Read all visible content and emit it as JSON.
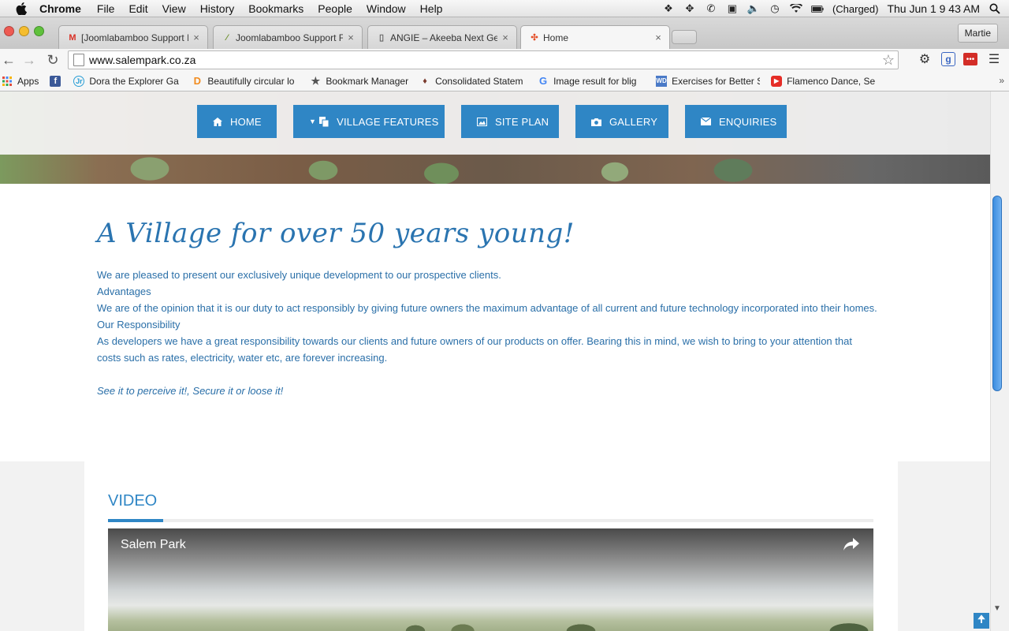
{
  "menubar": {
    "app_name": "Chrome",
    "items": [
      "File",
      "Edit",
      "View",
      "History",
      "Bookmarks",
      "People",
      "Window",
      "Help"
    ],
    "battery_text": "(Charged)",
    "clock": "Thu Jun 1  9 43 AM"
  },
  "tabs": [
    {
      "title": "[Joomlabamboo Support Fo",
      "favicon": "gmail-icon",
      "active": false
    },
    {
      "title": "Joomlabamboo Support Fo",
      "favicon": "joomlabamboo-icon",
      "active": false
    },
    {
      "title": "ANGIE – Akeeba Next Gen",
      "favicon": "document-icon",
      "active": false
    },
    {
      "title": "Home",
      "favicon": "joomla-icon",
      "active": true
    }
  ],
  "profile_button": "Martie",
  "address_bar": {
    "url": "www.salempark.co.za"
  },
  "bookmarks": [
    {
      "label": "Apps",
      "icon": "apps-grid-icon"
    },
    {
      "label": "",
      "icon": "facebook-icon"
    },
    {
      "label": "Dora the Explorer Ga",
      "icon": "jr-icon"
    },
    {
      "label": "Beautifully circular lo",
      "icon": "d-icon"
    },
    {
      "label": "Bookmark Manager",
      "icon": "star-icon"
    },
    {
      "label": "Consolidated Statem",
      "icon": "crest-icon"
    },
    {
      "label": "Image result for blig",
      "icon": "google-icon"
    },
    {
      "label": "Exercises for Better S",
      "icon": "wd-icon"
    },
    {
      "label": "Flamenco Dance, Sev",
      "icon": "youtube-icon"
    }
  ],
  "nav": [
    {
      "label": "HOME",
      "icon": "home-icon"
    },
    {
      "label": "VILLAGE FEATURES",
      "icon": "copy-icon",
      "dropdown": true
    },
    {
      "label": "SITE PLAN",
      "icon": "image-icon"
    },
    {
      "label": "GALLERY",
      "icon": "camera-icon"
    },
    {
      "label": "ENQUIRIES",
      "icon": "envelope-icon"
    }
  ],
  "content": {
    "headline": "A Village for over 50 years young!",
    "intro": "We are pleased to present our exclusively unique development to our prospective clients.",
    "advantages_heading": "Advantages",
    "advantages_text": "We are of the opinion that it is our duty to act responsibly by giving future owners the maximum advantage of all current and future technology incorporated into their homes.",
    "responsibility_heading": "Our Responsibility",
    "responsibility_text": "As developers we have a great responsibility towards our clients and future owners of our products on offer. Bearing this in mind, we wish to bring to your attention that costs such as rates, electricity, water etc, are forever increasing.",
    "tagline": "See it to perceive it!, Secure it or loose it!"
  },
  "video_section": {
    "heading": "VIDEO",
    "video_title": "Salem Park"
  },
  "colors": {
    "accent": "#2f86c5",
    "text_blue": "#2a6fa8"
  }
}
